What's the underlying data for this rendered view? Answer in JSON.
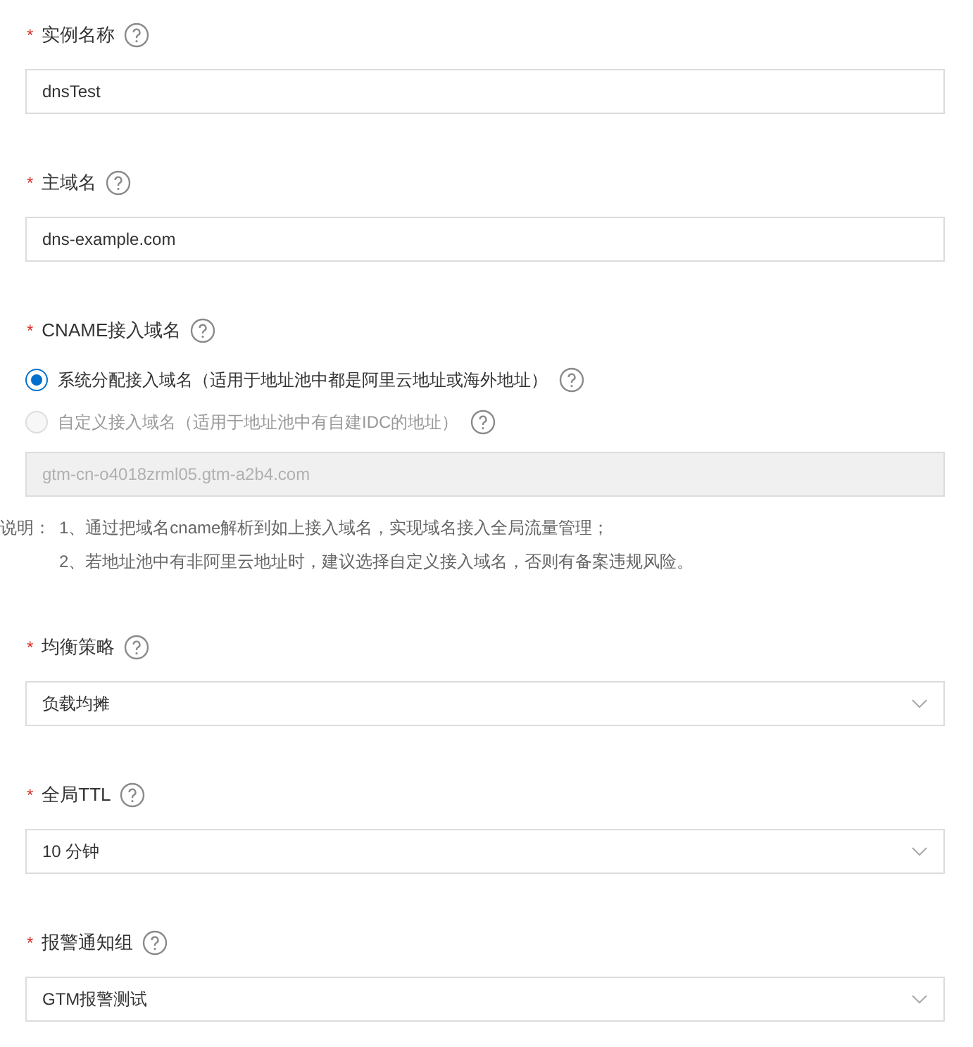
{
  "fields": [
    {
      "kind": "input",
      "mark": "*",
      "label": "实例名称",
      "value": "dnsTest"
    },
    {
      "kind": "input",
      "mark": "*",
      "label": "主域名",
      "value": "dns-example.com"
    },
    {
      "kind": "radio_group",
      "mark": "*",
      "label": "CNAME接入域名",
      "options": [
        {
          "label": "系统分配接入域名（适用于地址池中都是阿里云地址或海外地址）",
          "selected": true,
          "disabled": false
        },
        {
          "label": "自定义接入域名（适用于地址池中有自建IDC的地址）",
          "selected": false,
          "disabled": true
        }
      ],
      "input": {
        "value": "gtm-cn-o4018zrml05.gtm-a2b4.com",
        "disabled": true
      },
      "note": {
        "label": "说明：",
        "lines": [
          "1、通过把域名cname解析到如上接入域名，实现域名接入全局流量管理；",
          "2、若地址池中有非阿里云地址时，建议选择自定义接入域名，否则有备案违规风险。"
        ]
      }
    },
    {
      "kind": "select",
      "mark": "*",
      "label": "均衡策略",
      "value": "负载均摊"
    },
    {
      "kind": "select",
      "mark": "*",
      "label": "全局TTL",
      "value": "10 分钟"
    },
    {
      "kind": "select",
      "mark": "*",
      "label": "报警通知组",
      "value": "GTM报警测试"
    }
  ]
}
